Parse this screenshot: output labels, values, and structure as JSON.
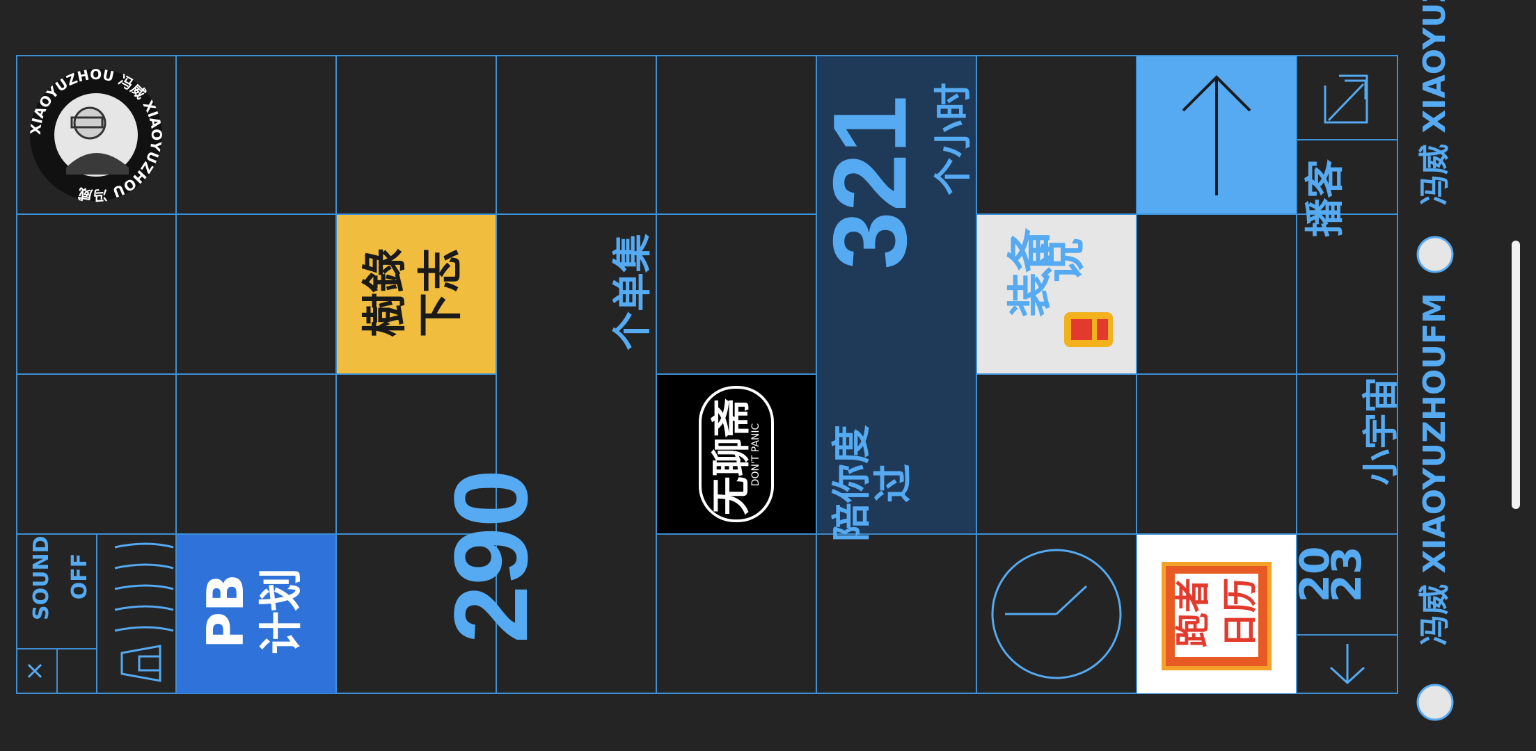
{
  "colors": {
    "background": "#242424",
    "grid_line": "#3d8fd6",
    "accent": "#55aaf2",
    "highlight_panel": "#1f3a58",
    "share_tile": "#55aaf2",
    "pb_tile": "#2f73da",
    "shuxia_tile": "#f0bd3e"
  },
  "sound": {
    "label_sound": "SOUND",
    "label_off": "OFF"
  },
  "close_symbol": "×",
  "pb_plan": {
    "top": "PB",
    "bottom": "计划"
  },
  "shuxia": {
    "line1": "樹錄",
    "line2": "下志"
  },
  "episodes": {
    "count": "290",
    "unit": "个单集"
  },
  "wuliao": {
    "title": "无聊斋",
    "subtitle": "DON'T PANIC"
  },
  "hours": {
    "lead": "陪你度过",
    "count": "321",
    "unit": "个小时"
  },
  "zhuangbei": {
    "top": "装备",
    "bottom": "说"
  },
  "paozhe": {
    "line1": "跑者",
    "line2": "日历"
  },
  "podcast_label": "播客",
  "brand": {
    "year_top": "20",
    "year_bottom": "23",
    "name": "小宇宙"
  },
  "avatar_ring_text": "XIAOYUZHOU 冯威 XIAOYUZHOU 冯威",
  "footer": {
    "text1": "冯威  XIAOYUZHOUFM",
    "text2": "冯威  XIAOYUZHOU"
  },
  "icons": [
    "avatar",
    "close-icon",
    "speaker-icon",
    "arrow-up-icon",
    "expand-icon",
    "clock-icon",
    "arrow-down-icon"
  ]
}
